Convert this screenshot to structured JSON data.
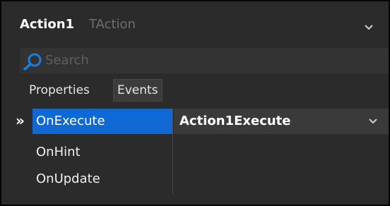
{
  "header": {
    "component_name": "Action1",
    "component_type": "TAction"
  },
  "search": {
    "placeholder": "Search"
  },
  "tabs": [
    {
      "label": "Properties",
      "active": false
    },
    {
      "label": "Events",
      "active": true
    }
  ],
  "events": [
    {
      "name": "OnExecute",
      "value": "Action1Execute",
      "selected": true
    },
    {
      "name": "OnHint",
      "value": "",
      "selected": false
    },
    {
      "name": "OnUpdate",
      "value": "",
      "selected": false
    }
  ],
  "marker": "»",
  "colors": {
    "background": "#2b2b2b",
    "selection": "#1068d4",
    "search_icon": "#1a7ee0"
  }
}
